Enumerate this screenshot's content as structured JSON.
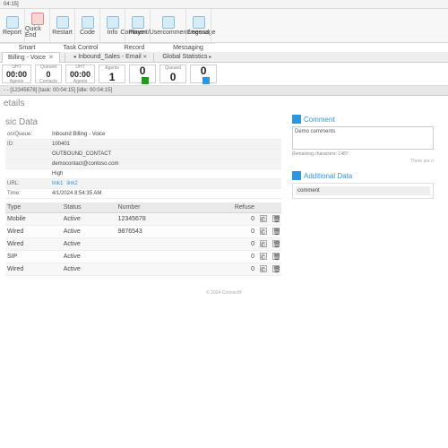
{
  "window": {
    "title": "04:15]"
  },
  "ribbon": {
    "buttons": [
      "Report",
      "Quick End",
      "Restart",
      "Code",
      "Info",
      "Player",
      "Comment/Usercomment/message",
      "Legend"
    ],
    "groups": [
      "Smart",
      "Task Control",
      "Record",
      "Messaging"
    ]
  },
  "tabs": {
    "items": [
      "Billing - Voice",
      "Inbound_Sales - Email",
      "Global Statistics"
    ]
  },
  "stats": {
    "b0": {
      "l": "UHT",
      "v": "00:00",
      "s": "Agents"
    },
    "b1": {
      "l": "Queued",
      "v": "0",
      "s": "Contacts"
    },
    "b2": {
      "l": "UHT",
      "v": "00:00",
      "s": "Agents"
    },
    "b3": {
      "l": "Agents",
      "v": "1"
    },
    "b4": {
      "v": "0"
    },
    "b5": {
      "l": "Queued",
      "v": "0"
    },
    "b6": {
      "v": "0"
    }
  },
  "breadcrumb": "- - [12345678] [task: 00:04:15] [idle: 00:04:15]",
  "headers": {
    "details": "etails",
    "basic": "sic Data",
    "comment": "Comment",
    "additional": "Additional Data"
  },
  "basic": {
    "queue_k": "on/Queue:",
    "queue_v": "Inbound Billing - Voice",
    "id_k": "ID:",
    "id_v": "100401",
    "type_v": "OUTBOUND_CONTACT",
    "email_v": "democontact@contoso.com",
    "prio_v": "High",
    "url_k": "URL:",
    "url_links": [
      "link1",
      "link2"
    ],
    "time_k": "Time:",
    "time_v": "4/1/2024 8:54:35 AM"
  },
  "table": {
    "cols": [
      "Type",
      "Status",
      "Number",
      "Refuse",
      "",
      ""
    ],
    "rows": [
      {
        "type": "Mobile",
        "status": "Active",
        "number": "12345678",
        "refuse": "0"
      },
      {
        "type": "Wired",
        "status": "Active",
        "number": "9876543",
        "refuse": "0"
      },
      {
        "type": "Wired",
        "status": "Active",
        "number": "",
        "refuse": "0"
      },
      {
        "type": "SIP",
        "status": "Active",
        "number": "",
        "refuse": "0"
      },
      {
        "type": "Wired",
        "status": "Active",
        "number": "",
        "refuse": "0"
      }
    ]
  },
  "comment": {
    "text": "Demo comments",
    "remain": "Remaining characters: 1487",
    "note": "There are n"
  },
  "additional": {
    "row": "comment"
  },
  "footer": "© 2024 Connect®"
}
